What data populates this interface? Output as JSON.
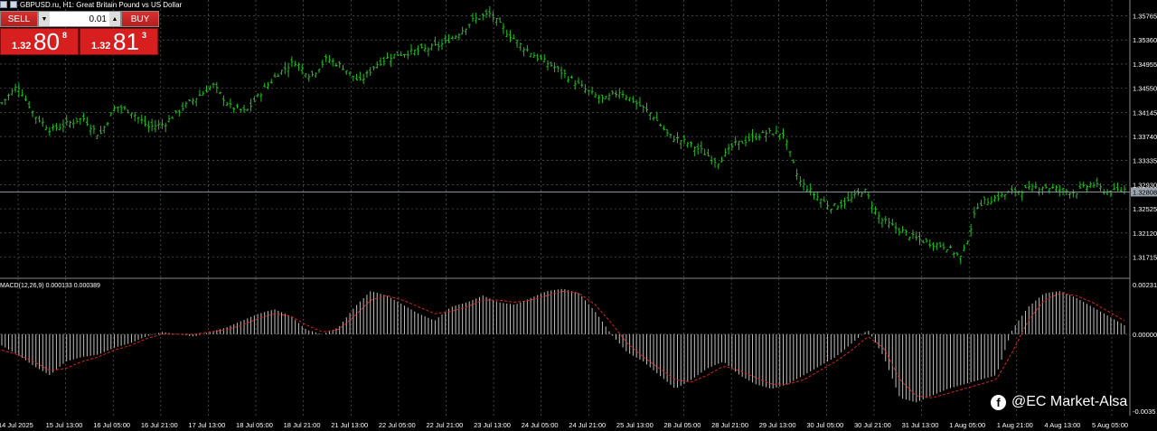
{
  "header": {
    "symbol_title": "GBPUSD.ru, H1:  Great Britain Pound vs US Dollar"
  },
  "trade_panel": {
    "sell_label": "SELL",
    "buy_label": "BUY",
    "lot_value": "0.01",
    "sell_quote": {
      "prefix": "1.32",
      "big": "80",
      "sup": "8"
    },
    "buy_quote": {
      "prefix": "1.32",
      "big": "81",
      "sup": "3"
    }
  },
  "macd_label": "MACD(12,26,9) 0.000133 0.000389",
  "watermark": "@EC Market-Alsa",
  "colors": {
    "background": "#000000",
    "candles": "#1fbe1f",
    "grid": "#6b6b6b",
    "histogram": "#c0c0c0",
    "signal": "#e02020"
  },
  "chart_data": [
    {
      "type": "bar",
      "style": "ohlc",
      "title": "GBPUSD.ru, H1:  Great Britain Pound vs US Dollar",
      "xlabel": "",
      "ylabel": "",
      "ylim": [
        1.3148,
        1.3594
      ],
      "grid": true,
      "y_ticks": [
        "1.35765",
        "1.35360",
        "1.34955",
        "1.34550",
        "1.34145",
        "1.33740",
        "1.33335",
        "1.32930",
        "1.32525",
        "1.32120",
        "1.31715"
      ],
      "current_price": "1.32808",
      "x_ticks": [
        "14 Jul 2025",
        "15 Jul 13:00",
        "16 Jul 05:00",
        "16 Jul 21:00",
        "17 Jul 13:00",
        "18 Jul 05:00",
        "18 Jul 21:00",
        "21 Jul 13:00",
        "22 Jul 05:00",
        "22 Jul 21:00",
        "23 Jul 13:00",
        "24 Jul 05:00",
        "24 Jul 21:00",
        "25 Jul 13:00",
        "28 Jul 05:00",
        "28 Jul 21:00",
        "29 Jul 13:00",
        "30 Jul 05:00",
        "30 Jul 21:00",
        "31 Jul 13:00",
        "1 Aug 05:00",
        "1 Aug 21:00",
        "4 Aug 13:00",
        "5 Aug 05:00"
      ],
      "series": [
        {
          "values": [
            1.343,
            1.346,
            1.341,
            1.3385,
            1.3395,
            1.3405,
            1.3375,
            1.3425,
            1.3415,
            1.339,
            1.3395,
            1.342,
            1.344,
            1.346,
            1.3425,
            1.3415,
            1.345,
            1.348,
            1.35,
            1.3475,
            1.3505,
            1.349,
            1.3465,
            1.3495,
            1.351,
            1.3515,
            1.352,
            1.3528,
            1.3545,
            1.357,
            1.358,
            1.355,
            1.3525,
            1.3505,
            1.349,
            1.347,
            1.345,
            1.3435,
            1.345,
            1.343,
            1.341,
            1.3375,
            1.3365,
            1.335,
            1.333,
            1.336,
            1.337,
            1.338,
            1.338,
            1.33,
            1.3275,
            1.3255,
            1.3265,
            1.3285,
            1.3235,
            1.322,
            1.3205,
            1.3195,
            1.319,
            1.317,
            1.326,
            1.327,
            1.328,
            1.3285,
            1.329,
            1.3285,
            1.328,
            1.3295,
            1.328,
            1.3285
          ]
        }
      ]
    },
    {
      "type": "bar",
      "title": "MACD(12,26,9) 0.000133 0.000389",
      "xlabel": "",
      "ylabel": "",
      "ylim": [
        -0.0035,
        0.0023
      ],
      "grid": true,
      "y_ticks": [
        "0.00231",
        "0.00000",
        "-0.0035"
      ],
      "series": [
        {
          "name": "MACD",
          "values": [
            -0.0005,
            -0.0009,
            -0.0014,
            -0.0018,
            -0.0012,
            -0.001,
            -0.0009,
            -0.0006,
            -0.0004,
            -0.0001,
            0.0001,
            0.0,
            -0.0001,
            0.0001,
            0.0003,
            0.0006,
            0.0009,
            0.0011,
            0.0008,
            0.0002,
            0.0,
            0.0003,
            0.0012,
            0.0019,
            0.0017,
            0.0013,
            0.0009,
            0.0006,
            0.0012,
            0.0014,
            0.0017,
            0.0014,
            0.0013,
            0.0016,
            0.0019,
            0.002,
            0.0018,
            0.001,
            0.0,
            -0.0008,
            -0.0012,
            -0.0018,
            -0.0024,
            -0.002,
            -0.0015,
            -0.0012,
            -0.0018,
            -0.0022,
            -0.0024,
            -0.0022,
            -0.0018,
            -0.0014,
            -0.001,
            -0.0004,
            0.0002,
            -0.001,
            -0.0028,
            -0.003,
            -0.0027,
            -0.0024,
            -0.0022,
            -0.002,
            -0.0018,
            0.0002,
            0.0012,
            0.0018,
            0.0019,
            0.0016,
            0.0012,
            0.0008,
            0.0004
          ]
        },
        {
          "name": "Signal",
          "values": [
            -0.0007,
            -0.0009,
            -0.0012,
            -0.0016,
            -0.0015,
            -0.0012,
            -0.001,
            -0.0007,
            -0.0005,
            -0.0002,
            0.0,
            0.0,
            0.0,
            0.0001,
            0.0002,
            0.0004,
            0.0007,
            0.0009,
            0.0008,
            0.0004,
            0.0001,
            0.0002,
            0.0008,
            0.0015,
            0.0017,
            0.0015,
            0.0012,
            0.0009,
            0.001,
            0.0012,
            0.0015,
            0.0015,
            0.0014,
            0.0015,
            0.0017,
            0.0019,
            0.0018,
            0.0013,
            0.0005,
            -0.0004,
            -0.001,
            -0.0015,
            -0.002,
            -0.0021,
            -0.0018,
            -0.0014,
            -0.0016,
            -0.0019,
            -0.0022,
            -0.0022,
            -0.002,
            -0.0016,
            -0.0012,
            -0.0007,
            -0.0001,
            -0.0006,
            -0.002,
            -0.0027,
            -0.0028,
            -0.0026,
            -0.0024,
            -0.0022,
            -0.002,
            -0.0008,
            0.0006,
            0.0015,
            0.0018,
            0.0017,
            0.0014,
            0.001,
            0.0006
          ]
        }
      ]
    }
  ]
}
